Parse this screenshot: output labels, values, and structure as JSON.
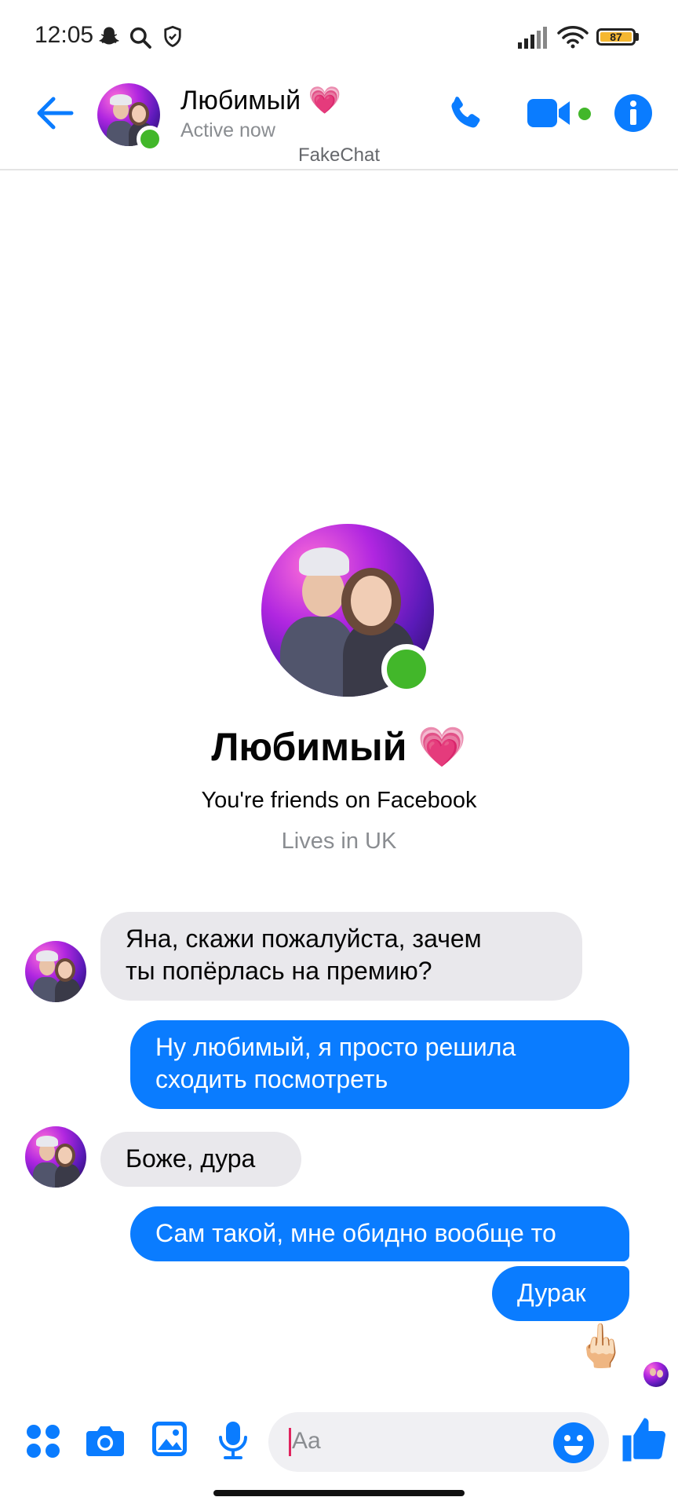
{
  "status_bar": {
    "time": "12:05",
    "battery": "87",
    "icons": [
      "snapchat-icon",
      "search-icon",
      "shield-icon",
      "signal-icon",
      "wifi-icon",
      "battery-icon"
    ]
  },
  "header": {
    "contact_name": "Любимый 💗",
    "contact_status": "Active now",
    "watermark": "FakeChat",
    "icons": [
      "back-arrow-icon",
      "phone-icon",
      "video-camera-icon",
      "info-icon"
    ]
  },
  "profile": {
    "name": "Любимый 💗",
    "friends_text": "You're friends on Facebook",
    "location_text": "Lives in UK"
  },
  "messages": [
    {
      "direction": "incoming",
      "lines": [
        "Яна, скажи пожалуйста, зачем",
        "ты попёрлась на премию?"
      ]
    },
    {
      "direction": "outgoing",
      "lines": [
        "Ну любимый, я просто решила",
        "сходить посмотреть"
      ]
    },
    {
      "direction": "incoming",
      "lines": [
        "Боже, дура"
      ]
    },
    {
      "direction": "outgoing",
      "lines": [
        "Сам такой, мне обидно вообще то"
      ]
    },
    {
      "direction": "outgoing",
      "lines": [
        "Дурак"
      ]
    }
  ],
  "reaction_emoji": "🖕🏻",
  "composer": {
    "placeholder": "Aa",
    "icons": [
      "menu-dots-icon",
      "camera-icon",
      "image-icon",
      "microphone-icon",
      "emoji-icon",
      "thumbs-up-icon"
    ]
  },
  "colors": {
    "accent": "#0a7cff",
    "online": "#42b72a",
    "incoming_bubble": "#e9e8ec"
  }
}
